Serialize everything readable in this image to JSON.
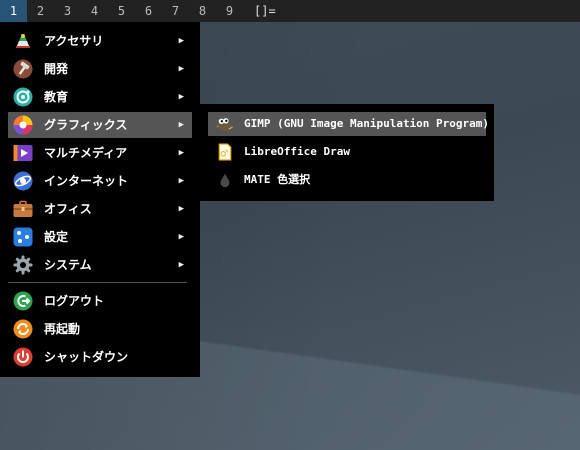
{
  "topbar": {
    "workspaces": [
      "1",
      "2",
      "3",
      "4",
      "5",
      "6",
      "7",
      "8",
      "9"
    ],
    "active_workspace": "1",
    "layout_symbol": "[]="
  },
  "menu": {
    "items": [
      {
        "label": "アクセサリ",
        "icon": "accessories-icon",
        "has_submenu": true
      },
      {
        "label": "開発",
        "icon": "development-icon",
        "has_submenu": true
      },
      {
        "label": "教育",
        "icon": "education-icon",
        "has_submenu": true
      },
      {
        "label": "グラフィックス",
        "icon": "graphics-icon",
        "has_submenu": true,
        "selected": true
      },
      {
        "label": "マルチメディア",
        "icon": "multimedia-icon",
        "has_submenu": true
      },
      {
        "label": "インターネット",
        "icon": "internet-icon",
        "has_submenu": true
      },
      {
        "label": "オフィス",
        "icon": "office-icon",
        "has_submenu": true
      },
      {
        "label": "設定",
        "icon": "settings-icon",
        "has_submenu": true
      },
      {
        "label": "システム",
        "icon": "system-icon",
        "has_submenu": true
      }
    ],
    "session": [
      {
        "label": "ログアウト",
        "icon": "logout-icon"
      },
      {
        "label": "再起動",
        "icon": "restart-icon"
      },
      {
        "label": "シャットダウン",
        "icon": "shutdown-icon"
      }
    ],
    "arrow_glyph": "▶"
  },
  "submenu": {
    "items": [
      {
        "label": "GIMP (GNU Image Manipulation Program)",
        "icon": "gimp-icon",
        "selected": true
      },
      {
        "label": "LibreOffice Draw",
        "icon": "libreoffice-draw-icon"
      },
      {
        "label": "MATE 色選択",
        "icon": "color-picker-icon"
      }
    ]
  },
  "colors": {
    "active_workspace": "#285577",
    "menu_bg": "#000000",
    "selected_bg": "#555555",
    "topbar_bg": "#222222"
  }
}
